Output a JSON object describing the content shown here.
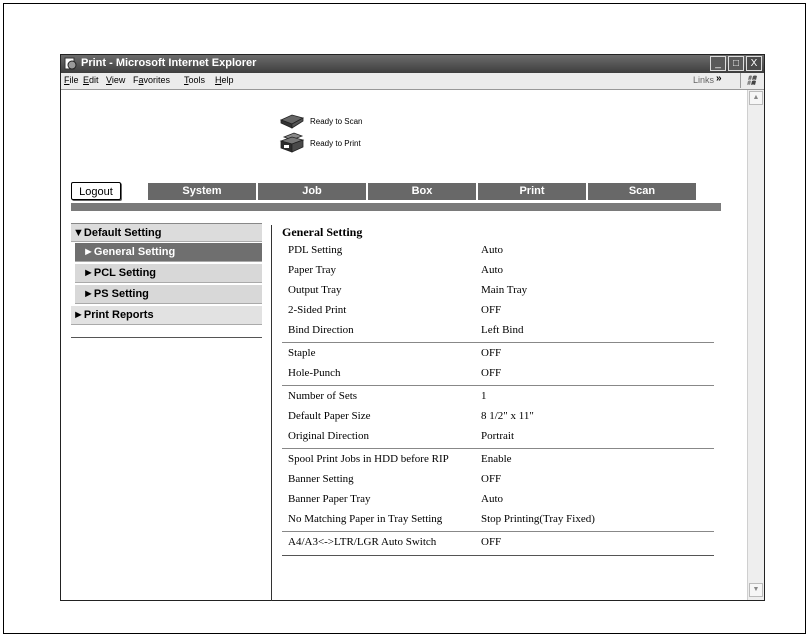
{
  "window": {
    "title": "Print - Microsoft Internet Explorer",
    "controls": [
      "_",
      "□",
      "X"
    ]
  },
  "menubar": {
    "items": [
      {
        "acc": "F",
        "rest": "ile"
      },
      {
        "acc": "E",
        "rest": "dit"
      },
      {
        "acc": "V",
        "rest": "iew"
      },
      {
        "pre": "F",
        "acc": "a",
        "rest": "vorites"
      },
      {
        "acc": "T",
        "rest": "ools"
      },
      {
        "acc": "H",
        "rest": "elp"
      }
    ],
    "links_label": "Links",
    "links_chevron": "»"
  },
  "status": {
    "scan": "Ready to Scan",
    "print": "Ready to Print"
  },
  "nav": {
    "logout": "Logout",
    "tabs": [
      "System",
      "Job",
      "Box",
      "Print",
      "Scan"
    ]
  },
  "sidebar": {
    "items": [
      {
        "label": "▼Default Setting"
      },
      {
        "label": "►General Setting"
      },
      {
        "label": "►PCL Setting"
      },
      {
        "label": "►PS Setting"
      },
      {
        "label": "►Print Reports"
      }
    ]
  },
  "settings": {
    "title": "General Setting",
    "rows": [
      {
        "label": "PDL Setting",
        "value": "Auto"
      },
      {
        "label": "Paper Tray",
        "value": "Auto"
      },
      {
        "label": "Output Tray",
        "value": "Main Tray"
      },
      {
        "label": "2-Sided Print",
        "value": "OFF"
      },
      {
        "label": "Bind Direction",
        "value": "Left Bind"
      },
      {
        "label": "Staple",
        "value": "OFF"
      },
      {
        "label": "Hole-Punch",
        "value": "OFF"
      },
      {
        "label": "Number of Sets",
        "value": "1"
      },
      {
        "label": "Default Paper Size",
        "value": "8 1/2\" x 11\""
      },
      {
        "label": "Original Direction",
        "value": "Portrait"
      },
      {
        "label": "Spool Print Jobs in HDD before RIP",
        "value": "Enable"
      },
      {
        "label": "Banner Setting",
        "value": "OFF"
      },
      {
        "label": "Banner Paper Tray",
        "value": "Auto"
      },
      {
        "label": "No Matching Paper in Tray Setting",
        "value": "Stop Printing(Tray Fixed)"
      },
      {
        "label": "A4/A3<->LTR/LGR Auto Switch",
        "value": "OFF"
      }
    ]
  },
  "icons": [
    "ie-page-icon",
    "minimize-icon",
    "maximize-icon",
    "close-icon",
    "windows-flag-icon",
    "scanner-icon",
    "printer-icon",
    "scroll-up-icon",
    "scroll-down-icon"
  ]
}
